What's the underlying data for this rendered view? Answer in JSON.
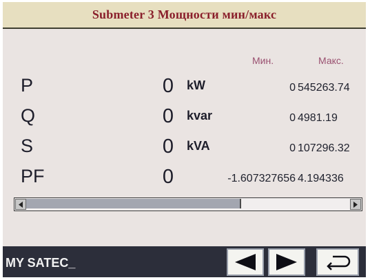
{
  "title": "Submeter 3 Мощности мин/макс",
  "columns": {
    "min": "Мин.",
    "max": "Макс."
  },
  "rows": [
    {
      "label": "P",
      "value": "0",
      "unit": "kW",
      "min": "0",
      "max": "545263.74"
    },
    {
      "label": "Q",
      "value": "0",
      "unit": "kvar",
      "min": "0",
      "max": "4981.19"
    },
    {
      "label": "S",
      "value": "0",
      "unit": "kVA",
      "min": "0",
      "max": "107296.32"
    },
    {
      "label": "PF",
      "value": "0",
      "unit": "",
      "min": "-1.607327656",
      "max": "4.194336"
    }
  ],
  "status": "MY SATEC_",
  "scrollbar": {
    "position": 0.66
  },
  "icons": {
    "prev": "left-arrow-icon",
    "next": "right-arrow-icon",
    "back": "return-icon"
  },
  "colors": {
    "title_text": "#8a1f2b",
    "title_bg": "#e7dfc0",
    "screen_bg": "#eae4e2",
    "bottom_bar": "#2c2e3a"
  }
}
